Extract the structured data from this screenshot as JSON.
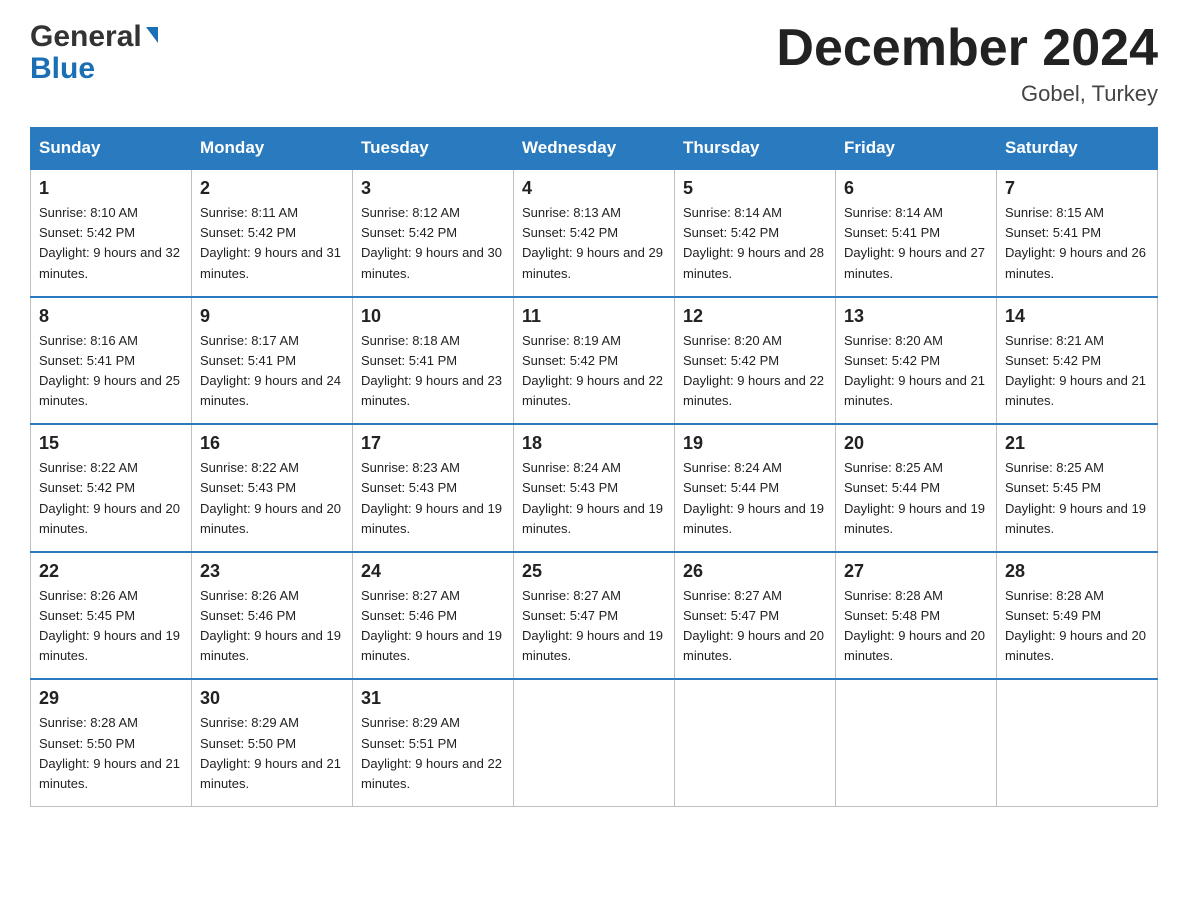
{
  "logo": {
    "general": "General",
    "blue": "Blue",
    "arrow": "▶"
  },
  "title": {
    "month_year": "December 2024",
    "location": "Gobel, Turkey"
  },
  "days_of_week": [
    "Sunday",
    "Monday",
    "Tuesday",
    "Wednesday",
    "Thursday",
    "Friday",
    "Saturday"
  ],
  "weeks": [
    [
      {
        "day": 1,
        "sunrise": "8:10 AM",
        "sunset": "5:42 PM",
        "daylight": "9 hours and 32 minutes."
      },
      {
        "day": 2,
        "sunrise": "8:11 AM",
        "sunset": "5:42 PM",
        "daylight": "9 hours and 31 minutes."
      },
      {
        "day": 3,
        "sunrise": "8:12 AM",
        "sunset": "5:42 PM",
        "daylight": "9 hours and 30 minutes."
      },
      {
        "day": 4,
        "sunrise": "8:13 AM",
        "sunset": "5:42 PM",
        "daylight": "9 hours and 29 minutes."
      },
      {
        "day": 5,
        "sunrise": "8:14 AM",
        "sunset": "5:42 PM",
        "daylight": "9 hours and 28 minutes."
      },
      {
        "day": 6,
        "sunrise": "8:14 AM",
        "sunset": "5:41 PM",
        "daylight": "9 hours and 27 minutes."
      },
      {
        "day": 7,
        "sunrise": "8:15 AM",
        "sunset": "5:41 PM",
        "daylight": "9 hours and 26 minutes."
      }
    ],
    [
      {
        "day": 8,
        "sunrise": "8:16 AM",
        "sunset": "5:41 PM",
        "daylight": "9 hours and 25 minutes."
      },
      {
        "day": 9,
        "sunrise": "8:17 AM",
        "sunset": "5:41 PM",
        "daylight": "9 hours and 24 minutes."
      },
      {
        "day": 10,
        "sunrise": "8:18 AM",
        "sunset": "5:41 PM",
        "daylight": "9 hours and 23 minutes."
      },
      {
        "day": 11,
        "sunrise": "8:19 AM",
        "sunset": "5:42 PM",
        "daylight": "9 hours and 22 minutes."
      },
      {
        "day": 12,
        "sunrise": "8:20 AM",
        "sunset": "5:42 PM",
        "daylight": "9 hours and 22 minutes."
      },
      {
        "day": 13,
        "sunrise": "8:20 AM",
        "sunset": "5:42 PM",
        "daylight": "9 hours and 21 minutes."
      },
      {
        "day": 14,
        "sunrise": "8:21 AM",
        "sunset": "5:42 PM",
        "daylight": "9 hours and 21 minutes."
      }
    ],
    [
      {
        "day": 15,
        "sunrise": "8:22 AM",
        "sunset": "5:42 PM",
        "daylight": "9 hours and 20 minutes."
      },
      {
        "day": 16,
        "sunrise": "8:22 AM",
        "sunset": "5:43 PM",
        "daylight": "9 hours and 20 minutes."
      },
      {
        "day": 17,
        "sunrise": "8:23 AM",
        "sunset": "5:43 PM",
        "daylight": "9 hours and 19 minutes."
      },
      {
        "day": 18,
        "sunrise": "8:24 AM",
        "sunset": "5:43 PM",
        "daylight": "9 hours and 19 minutes."
      },
      {
        "day": 19,
        "sunrise": "8:24 AM",
        "sunset": "5:44 PM",
        "daylight": "9 hours and 19 minutes."
      },
      {
        "day": 20,
        "sunrise": "8:25 AM",
        "sunset": "5:44 PM",
        "daylight": "9 hours and 19 minutes."
      },
      {
        "day": 21,
        "sunrise": "8:25 AM",
        "sunset": "5:45 PM",
        "daylight": "9 hours and 19 minutes."
      }
    ],
    [
      {
        "day": 22,
        "sunrise": "8:26 AM",
        "sunset": "5:45 PM",
        "daylight": "9 hours and 19 minutes."
      },
      {
        "day": 23,
        "sunrise": "8:26 AM",
        "sunset": "5:46 PM",
        "daylight": "9 hours and 19 minutes."
      },
      {
        "day": 24,
        "sunrise": "8:27 AM",
        "sunset": "5:46 PM",
        "daylight": "9 hours and 19 minutes."
      },
      {
        "day": 25,
        "sunrise": "8:27 AM",
        "sunset": "5:47 PM",
        "daylight": "9 hours and 19 minutes."
      },
      {
        "day": 26,
        "sunrise": "8:27 AM",
        "sunset": "5:47 PM",
        "daylight": "9 hours and 20 minutes."
      },
      {
        "day": 27,
        "sunrise": "8:28 AM",
        "sunset": "5:48 PM",
        "daylight": "9 hours and 20 minutes."
      },
      {
        "day": 28,
        "sunrise": "8:28 AM",
        "sunset": "5:49 PM",
        "daylight": "9 hours and 20 minutes."
      }
    ],
    [
      {
        "day": 29,
        "sunrise": "8:28 AM",
        "sunset": "5:50 PM",
        "daylight": "9 hours and 21 minutes."
      },
      {
        "day": 30,
        "sunrise": "8:29 AM",
        "sunset": "5:50 PM",
        "daylight": "9 hours and 21 minutes."
      },
      {
        "day": 31,
        "sunrise": "8:29 AM",
        "sunset": "5:51 PM",
        "daylight": "9 hours and 22 minutes."
      },
      null,
      null,
      null,
      null
    ]
  ]
}
